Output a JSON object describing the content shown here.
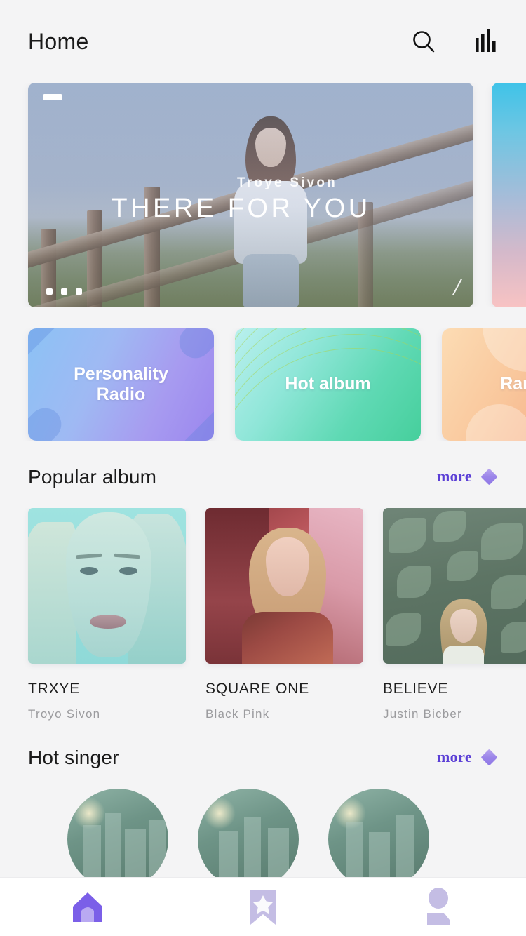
{
  "header": {
    "title": "Home",
    "search_icon": "search-icon",
    "equalizer_icon": "equalizer-icon"
  },
  "hero": {
    "badge": "",
    "slides": [
      {
        "artist": "Troye Sivon",
        "song": "THERE FOR YOU",
        "image_description": "woman leaning on wooden fence at dusk, blue haze tint"
      },
      {
        "artist": "",
        "song": "",
        "image_description": "cyan to pink vertical gradient"
      }
    ],
    "dots_count": 3,
    "active_dot": 0
  },
  "categories": [
    {
      "label": "Personality\nRadio",
      "accent": "#9b86ee"
    },
    {
      "label": "Hot album",
      "accent": "#46cf9c"
    },
    {
      "label": "Ranking",
      "accent": "#f39f7c"
    }
  ],
  "popular_album": {
    "section_title": "Popular album",
    "more_label": "more",
    "more_icon": "diamond-icon",
    "more_color": "#5b3fd6",
    "items": [
      {
        "title": "TRXYE",
        "artist": "Troyo Sivon",
        "thumb": "teal-portrait-closeup"
      },
      {
        "title": "SQUARE ONE",
        "artist": "Black Pink",
        "thumb": "warm-red-portrait"
      },
      {
        "title": "BELIEVE",
        "artist": "Justin Bicber",
        "thumb": "green-foliage-portrait"
      }
    ]
  },
  "hot_singer": {
    "section_title": "Hot singer",
    "more_label": "more",
    "more_icon": "diamond-icon",
    "more_color": "#5b3fd6",
    "items": [
      {
        "name": "",
        "avatar": "teal-cityscape"
      },
      {
        "name": "",
        "avatar": "teal-cityscape"
      },
      {
        "name": "",
        "avatar": "teal-cityscape"
      }
    ]
  },
  "bottom_nav": {
    "active_index": 0,
    "active_color": "#7b5fe8",
    "inactive_color": "#c4bde4",
    "items": [
      {
        "icon": "home-icon",
        "label": ""
      },
      {
        "icon": "bookmark-star-icon",
        "label": ""
      },
      {
        "icon": "person-icon",
        "label": ""
      }
    ]
  }
}
